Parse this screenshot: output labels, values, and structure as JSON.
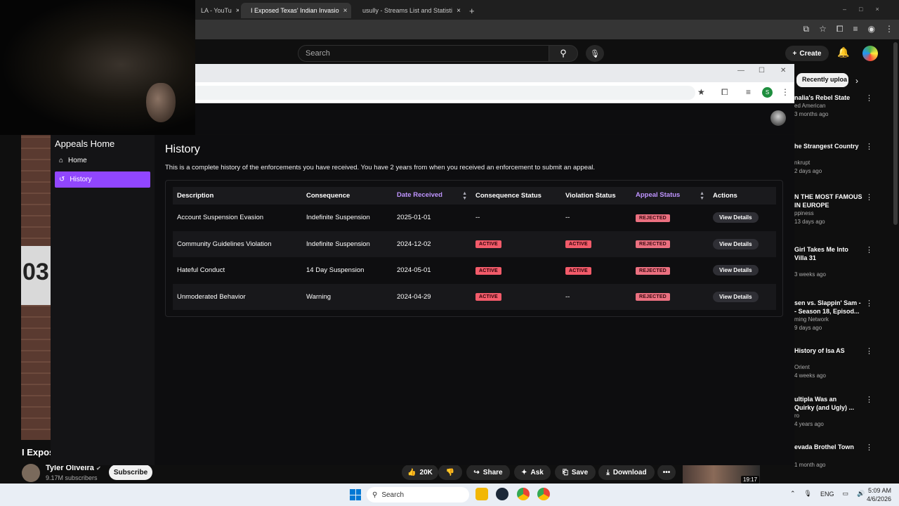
{
  "browser": {
    "tabs": [
      {
        "label": "LA - YouTu",
        "close": "×"
      },
      {
        "label": "I Exposed Texas' Indian Invasio",
        "close": "×",
        "active": true
      },
      {
        "label": "usully - Streams List and Statisti",
        "close": "×"
      }
    ],
    "new_tab": "+"
  },
  "youtube": {
    "search_placeholder": "Search",
    "create_label": "Create",
    "video_title": "I Expos",
    "channel_name": "Tyler Oliveira",
    "channel_subs": "9.17M subscribers",
    "subscribe_label": "Subscribe",
    "actions": {
      "like_count": "20K",
      "share": "Share",
      "ask": "Ask",
      "save": "Save",
      "download": "Download",
      "more": "•••"
    },
    "mini_duration": "19:17",
    "reco_chip": "Recently uploa",
    "recommendations": [
      {
        "title": "nalia's Rebel State",
        "channel": "ed American",
        "meta": "3 months ago"
      },
      {
        "title": "he Strangest Country",
        "channel": "nkrupt",
        "meta": "2 days ago"
      },
      {
        "title": "N THE MOST FAMOUS",
        "title2": "IN EUROPE",
        "channel": "ppiness",
        "meta": "13 days ago"
      },
      {
        "title": "Girl Takes Me Into",
        "title2": "Villa 31",
        "channel": "",
        "meta": "3 weeks ago"
      },
      {
        "title": "sen vs. Slappin' Sam -",
        "title2": "- Season 18, Episod...",
        "channel": "ming Network",
        "meta": "9 days ago"
      },
      {
        "title": "History of Isa AS",
        "channel": "Orient",
        "meta": "4 weeks ago"
      },
      {
        "title": "ultipla Was an",
        "title2": "Quirky (and Ugly) ...",
        "channel": "ro",
        "meta": "4 years ago"
      },
      {
        "title": "evada Brothel Town",
        "channel": "",
        "meta": "1 month ago"
      }
    ]
  },
  "popup": {
    "profile_letter": "S"
  },
  "appeals": {
    "sidebar_title": "Appeals Home",
    "nav": [
      {
        "label": "Home"
      },
      {
        "label": "History"
      }
    ],
    "page_title": "History",
    "description": "This is a complete history of the enforcements you have received. You have 2 years from when you received an enforcement to submit an appeal.",
    "columns": [
      "Description",
      "Consequence",
      "Date Received",
      "Consequence Status",
      "Violation Status",
      "Appeal Status",
      "Actions"
    ],
    "rows": [
      {
        "description": "Account Suspension Evasion",
        "consequence": "Indefinite Suspension",
        "date": "2025-01-01",
        "consequence_status": "--",
        "violation_status": "--",
        "appeal_status": "REJECTED",
        "action": "View Details"
      },
      {
        "description": "Community Guidelines Violation",
        "consequence": "Indefinite Suspension",
        "date": "2024-12-02",
        "consequence_status": "ACTIVE",
        "violation_status": "ACTIVE",
        "appeal_status": "REJECTED",
        "action": "View Details"
      },
      {
        "description": "Hateful Conduct",
        "consequence": "14 Day Suspension",
        "date": "2024-05-01",
        "consequence_status": "ACTIVE",
        "violation_status": "ACTIVE",
        "appeal_status": "REJECTED",
        "action": "View Details"
      },
      {
        "description": "Unmoderated Behavior",
        "consequence": "Warning",
        "date": "2024-04-29",
        "consequence_status": "ACTIVE",
        "violation_status": "--",
        "appeal_status": "REJECTED",
        "action": "View Details"
      }
    ],
    "accent_color": "#9146ff",
    "badge_color": "#eb7080"
  },
  "taskbar": {
    "search_placeholder": "Search",
    "language": "ENG",
    "time": "5:09 AM",
    "date": "4/6/2026"
  }
}
